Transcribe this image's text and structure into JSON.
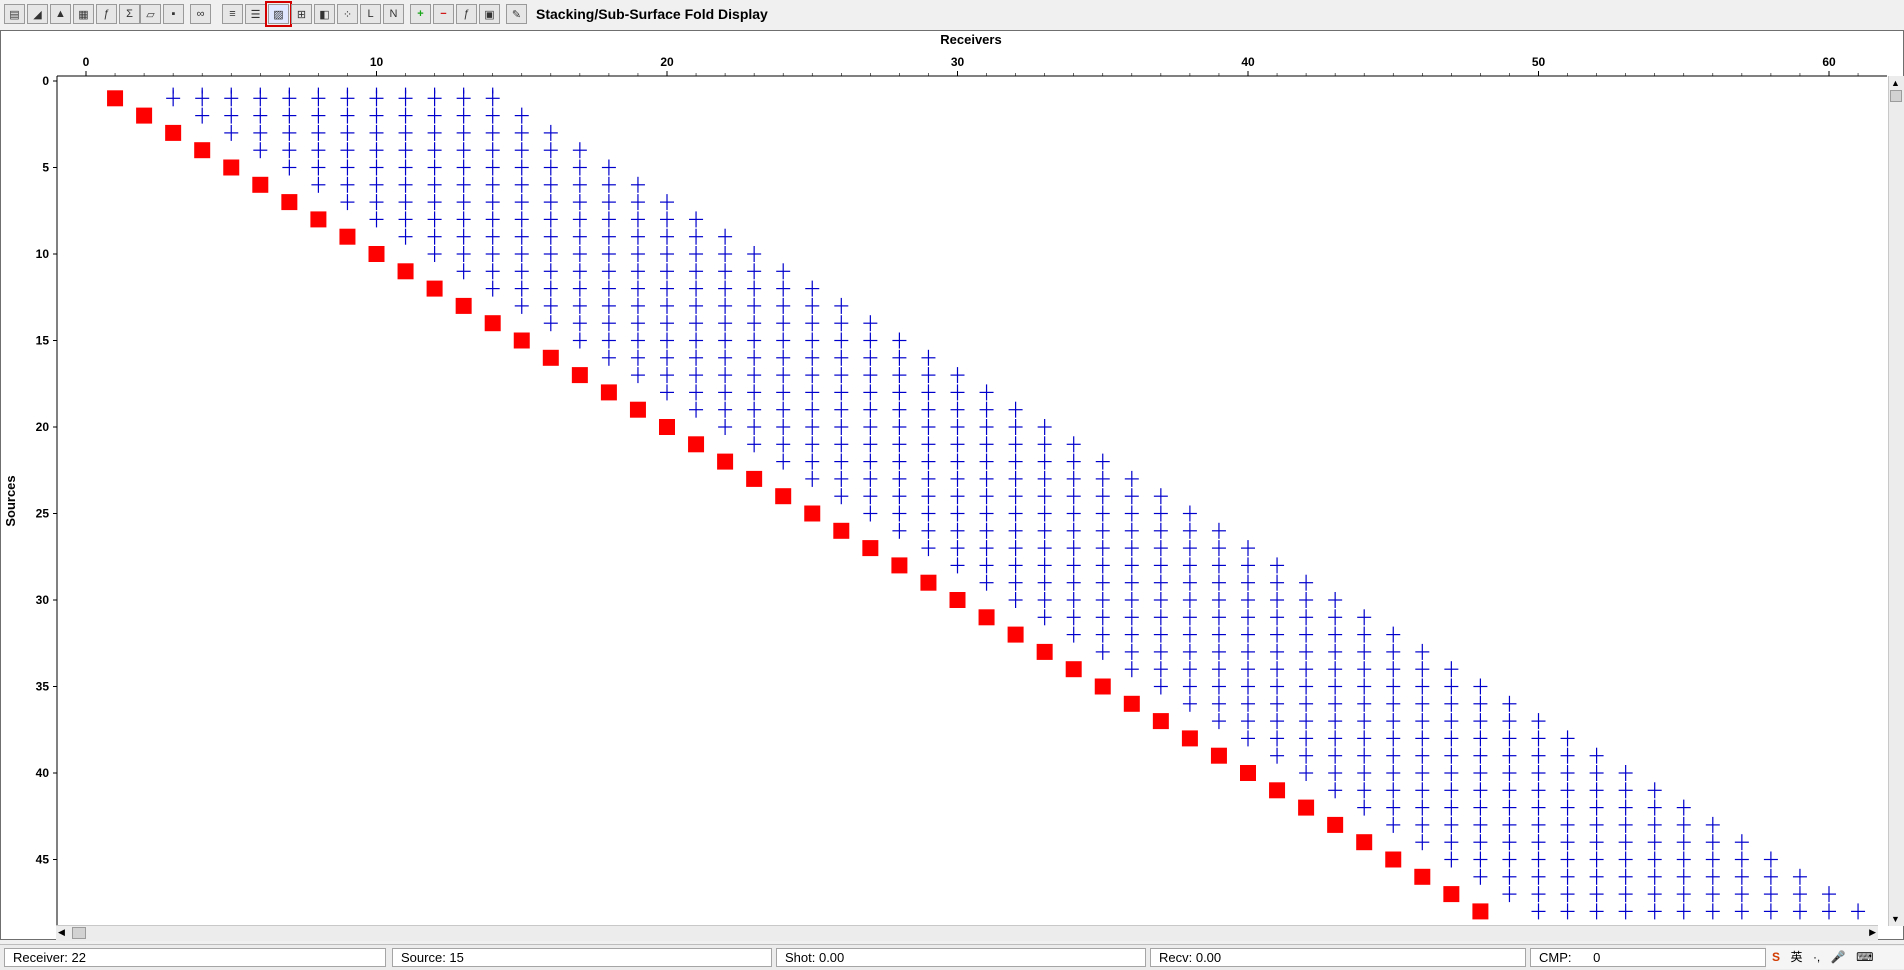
{
  "app": {
    "title": "Stacking/Sub-Surface Fold Display"
  },
  "toolbar": {
    "icons": [
      "new-icon",
      "color-ramp-icon",
      "flag-icon",
      "grid-icon",
      "fx-icon",
      "folder-open-icon",
      "save-icon",
      "binoculars-icon",
      "bars-icon",
      "stack-icon",
      "fold-icon",
      "table-icon",
      "color-palette-icon",
      "scatter-icon",
      "log-icon",
      "nlog-icon",
      "plus-icon",
      "minus-icon",
      "fx2-icon",
      "display-icon",
      "tools-icon"
    ]
  },
  "status": {
    "receiver": "Receiver: 22",
    "source": "Source: 15",
    "shot": "Shot: 0.00",
    "recv": "Recv: 0.00",
    "cmp_label": "CMP:",
    "cmp_value": "0"
  },
  "colors": {
    "cross": "#0000cc",
    "marker": "#ff0000",
    "grid_line": "#000000"
  },
  "chart_data": {
    "type": "scatter",
    "title": "",
    "xlabel": "Receivers",
    "ylabel": "Sources",
    "xlim": [
      -1,
      62
    ],
    "ylim": [
      0,
      48.5
    ],
    "x_ticks": [
      0,
      10,
      20,
      30,
      40,
      50,
      60
    ],
    "y_ticks": [
      0,
      5,
      10,
      15,
      20,
      25,
      30,
      35,
      40,
      45
    ],
    "series": [
      {
        "marker": "square",
        "description": "source positions: receiver = source",
        "points_rule": "diagonal",
        "start": 1,
        "end": 48
      },
      {
        "marker": "cross",
        "description": "active receivers for each source: from max(3,s+1) to min(14+s... pattern)"
      }
    ]
  }
}
